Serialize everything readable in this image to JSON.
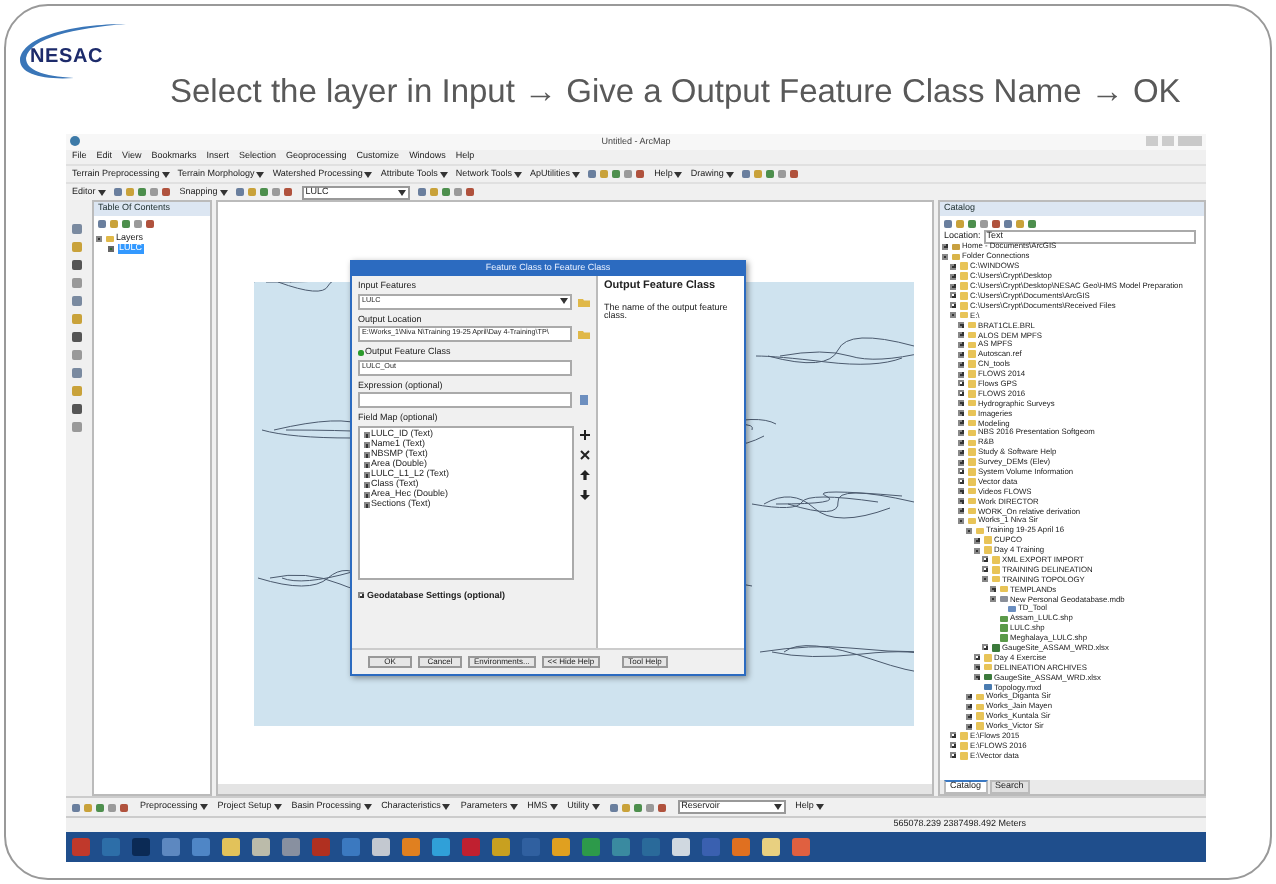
{
  "slide": {
    "logo": "NESAC",
    "title": "Select the layer in Input → Give a Output Feature Class Name → OK"
  },
  "window": {
    "title": "Untitled - ArcMap"
  },
  "menu": [
    "File",
    "Edit",
    "View",
    "Bookmarks",
    "Insert",
    "Selection",
    "Geoprocessing",
    "Customize",
    "Windows",
    "Help"
  ],
  "toolbar_1": [
    {
      "label": "Terrain Preprocessing",
      "kind": "menu"
    },
    {
      "label": "Terrain Morphology",
      "kind": "menu"
    },
    {
      "label": "Watershed Processing",
      "kind": "menu"
    },
    {
      "label": "Attribute Tools",
      "kind": "menu"
    },
    {
      "label": "Network Tools",
      "kind": "menu"
    },
    {
      "label": "ApUtilities",
      "kind": "menu"
    },
    {
      "kind": "tools"
    },
    {
      "label": "Help",
      "kind": "menu"
    },
    {
      "label": "Drawing",
      "kind": "menu"
    },
    {
      "kind": "tools"
    }
  ],
  "toolbar_2": [
    {
      "label": "Editor",
      "kind": "menu"
    },
    {
      "kind": "tools"
    },
    {
      "label": "Snapping",
      "kind": "menu"
    },
    {
      "kind": "tools"
    },
    {
      "label": "LULC",
      "kind": "dropdown"
    },
    {
      "kind": "tools"
    }
  ],
  "toc": {
    "title": "Table Of Contents",
    "layers": {
      "label": "Layers",
      "expanded": true,
      "children": [
        {
          "label": "LULC",
          "checked": true,
          "selected": true
        }
      ]
    }
  },
  "dialog": {
    "title": "Feature Class to Feature Class",
    "fields": [
      {
        "label": "Input Features",
        "value": "LULC",
        "kind": "dropdown",
        "required": false
      },
      {
        "label": "Output Location",
        "value": "E:\\Works_1\\Niva N\\Training 19-25 April\\Day 4-Training\\TP\\",
        "kind": "folder",
        "required": false
      },
      {
        "label": "Output Feature Class",
        "value": "LULC_Out",
        "kind": "text",
        "required": true
      },
      {
        "label": "Expression (optional)",
        "kind": "sql",
        "required": false
      }
    ],
    "field_map": {
      "label": "Field Map (optional)",
      "items": [
        "LULC_ID (Text)",
        "Name1 (Text)",
        "NBSMP (Text)",
        "Area (Double)",
        "LULC_L1_L2 (Text)",
        "Class (Text)",
        "Area_Hec (Double)",
        "Sections (Text)"
      ]
    },
    "settings": {
      "label": "Geodatabase Settings (optional)",
      "expanded": false
    },
    "buttons": [
      "OK",
      "Cancel",
      "Environments...",
      "<< Hide Help",
      "Tool Help"
    ],
    "help": {
      "title": "Output Feature Class",
      "text": "The name of the output feature class."
    }
  },
  "catalog": {
    "title": "Catalog",
    "location_label": "Location:",
    "location": "Text",
    "tree": [
      {
        "label": "Home - Documents\\ArcGIS",
        "kind": "home",
        "expanded": false
      },
      {
        "label": "Folder Connections",
        "kind": "connections",
        "expanded": true,
        "children": [
          {
            "label": "C:\\WINDOWS",
            "kind": "folder",
            "expanded": false
          },
          {
            "label": "C:\\Users\\Crypt\\Desktop",
            "kind": "folder",
            "expanded": false
          },
          {
            "label": "C:\\Users\\Crypt\\Desktop\\NESAC Geo\\HMS Model Preparation",
            "kind": "folder",
            "expanded": false
          },
          {
            "label": "C:\\Users\\Crypt\\Documents\\ArcGIS",
            "kind": "folder",
            "expanded": false
          },
          {
            "label": "C:\\Users\\Crypt\\Documents\\Received Files",
            "kind": "folder",
            "expanded": false
          },
          {
            "label": "E:\\",
            "kind": "folder",
            "expanded": true,
            "children": [
              {
                "label": "BRAT1CLE.BRL",
                "kind": "folder",
                "expanded": false
              },
              {
                "label": "ALOS DEM MPFS",
                "kind": "folder",
                "expanded": false
              },
              {
                "label": "AS MPFS",
                "kind": "folder",
                "expanded": false
              },
              {
                "label": "Autoscan.ref",
                "kind": "folder",
                "expanded": false
              },
              {
                "label": "CN_tools",
                "kind": "folder",
                "expanded": false
              },
              {
                "label": "FLOWS 2014",
                "kind": "folder",
                "expanded": false
              },
              {
                "label": "Flows GPS",
                "kind": "folder",
                "expanded": false
              },
              {
                "label": "FLOWS 2016",
                "kind": "folder",
                "expanded": false
              },
              {
                "label": "Hydrographic Surveys",
                "kind": "folder",
                "expanded": false
              },
              {
                "label": "Imageries",
                "kind": "folder",
                "expanded": false
              },
              {
                "label": "Modeling",
                "kind": "folder",
                "expanded": false
              },
              {
                "label": "NBS 2016 Presentation Softgeom",
                "kind": "folder",
                "expanded": false
              },
              {
                "label": "R&B",
                "kind": "folder",
                "expanded": false
              },
              {
                "label": "Study & Software Help",
                "kind": "folder",
                "expanded": false
              },
              {
                "label": "Survey_DEMs (Elev)",
                "kind": "folder",
                "expanded": false
              },
              {
                "label": "System Volume Information",
                "kind": "folder",
                "expanded": false
              },
              {
                "label": "Vector data",
                "kind": "folder",
                "expanded": false
              },
              {
                "label": "Videos FLOWS",
                "kind": "folder",
                "expanded": false
              },
              {
                "label": "Work DIRECTOR",
                "kind": "folder",
                "expanded": false
              },
              {
                "label": "WORK_On relative derivation",
                "kind": "folder",
                "expanded": false
              },
              {
                "label": "Works_1 Niva Sir",
                "kind": "folder",
                "expanded": true,
                "children": [
                  {
                    "label": "Training 19-25 April 16",
                    "kind": "folder",
                    "expanded": true,
                    "children": [
                      {
                        "label": "CUPCO",
                        "kind": "folder",
                        "expanded": false
                      },
                      {
                        "label": "Day 4 Training",
                        "kind": "folder",
                        "expanded": true,
                        "children": [
                          {
                            "label": "XML EXPORT IMPORT",
                            "kind": "folder",
                            "expanded": false
                          },
                          {
                            "label": "TRAINING DELINEATION",
                            "kind": "folder",
                            "expanded": false
                          },
                          {
                            "label": "TRAINING TOPOLOGY",
                            "kind": "folder",
                            "expanded": true,
                            "children": [
                              {
                                "label": "TEMPLANDs",
                                "kind": "folder",
                                "expanded": false
                              },
                              {
                                "label": "New Personal Geodatabase.mdb",
                                "kind": "gdb",
                                "expanded": true,
                                "children": [
                                  {
                                    "label": "TD_Tool",
                                    "kind": "dataset"
                                  }
                                ]
                              },
                              {
                                "label": "Assam_LULC.shp",
                                "kind": "shapefile"
                              },
                              {
                                "label": "LULC.shp",
                                "kind": "shapefile"
                              },
                              {
                                "label": "Meghalaya_LULC.shp",
                                "kind": "shapefile"
                              }
                            ]
                          },
                          {
                            "label": "GaugeSite_ASSAM_WRD.xlsx",
                            "kind": "table",
                            "expanded": false
                          }
                        ]
                      },
                      {
                        "label": "Day 4 Exercise",
                        "kind": "folder",
                        "expanded": false
                      },
                      {
                        "label": "DELINEATION ARCHIVES",
                        "kind": "folder",
                        "expanded": false
                      },
                      {
                        "label": "GaugeSite_ASSAM_WRD.xlsx",
                        "kind": "table",
                        "expanded": false
                      },
                      {
                        "label": "Topology.mxd",
                        "kind": "map"
                      }
                    ]
                  },
                  {
                    "label": "Works_Diganta Sir",
                    "kind": "folder",
                    "expanded": false
                  },
                  {
                    "label": "Works_Jain Mayen",
                    "kind": "folder",
                    "expanded": false
                  },
                  {
                    "label": "Works_Kuntala Sir",
                    "kind": "folder",
                    "expanded": false
                  },
                  {
                    "label": "Works_Victor Sir",
                    "kind": "folder",
                    "expanded": false
                  }
                ]
              }
            ]
          },
          {
            "label": "E:\\Flows 2015",
            "kind": "folder",
            "expanded": false
          },
          {
            "label": "E:\\FLOWS 2016",
            "kind": "folder",
            "expanded": false
          },
          {
            "label": "E:\\Vector data",
            "kind": "folder",
            "expanded": false
          }
        ]
      }
    ],
    "tabs": [
      {
        "label": "Catalog",
        "selected": true
      },
      {
        "label": "Search",
        "selected": false
      }
    ]
  },
  "toolbar_bottom": [
    {
      "kind": "tools"
    },
    {
      "label": "Preprocessing",
      "kind": "menu"
    },
    {
      "label": "Project Setup",
      "kind": "menu"
    },
    {
      "label": "Basin Processing",
      "kind": "menu"
    },
    {
      "label": "Characteristics",
      "kind": "menu"
    },
    {
      "label": "Parameters",
      "kind": "menu"
    },
    {
      "label": "HMS",
      "kind": "menu"
    },
    {
      "label": "Utility",
      "kind": "menu"
    },
    {
      "kind": "tools"
    },
    {
      "label": "Reservoir",
      "kind": "dropdown"
    },
    {
      "label": "Help",
      "kind": "menu"
    }
  ],
  "status_bar": {
    "coordinates": "565078.239 2387498.492 Meters"
  }
}
